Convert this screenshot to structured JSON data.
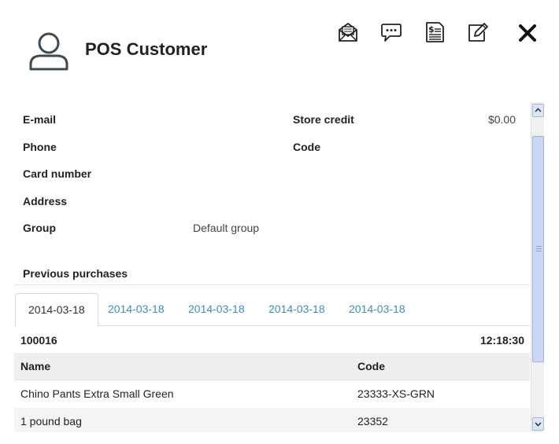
{
  "header": {
    "title": "POS Customer",
    "icons": [
      "avatar-icon",
      "email-icon",
      "message-icon",
      "invoice-icon",
      "edit-icon",
      "close-icon"
    ]
  },
  "fields": {
    "email_label": "E-mail",
    "phone_label": "Phone",
    "card_label": "Card number",
    "address_label": "Address",
    "group_label": "Group",
    "group_value": "Default group",
    "store_credit_label": "Store credit",
    "store_credit_value": "$0.00",
    "code_label": "Code"
  },
  "purchases": {
    "section_label": "Previous purchases",
    "tabs": [
      {
        "label": "2014-03-18",
        "active": true
      },
      {
        "label": "2014-03-18",
        "active": false
      },
      {
        "label": "2014-03-18",
        "active": false
      },
      {
        "label": "2014-03-18",
        "active": false
      },
      {
        "label": "2014-03-18",
        "active": false
      }
    ],
    "order_id": "100016",
    "order_time": "12:18:30",
    "columns": {
      "name": "Name",
      "code": "Code"
    },
    "rows": [
      {
        "name": "Chino Pants Extra Small Green",
        "code": "23333-XS-GRN"
      },
      {
        "name": "1 pound bag",
        "code": "23352"
      }
    ]
  },
  "colors": {
    "link": "#3a8fc0",
    "text": "#222222",
    "header_row": "#efefef"
  }
}
